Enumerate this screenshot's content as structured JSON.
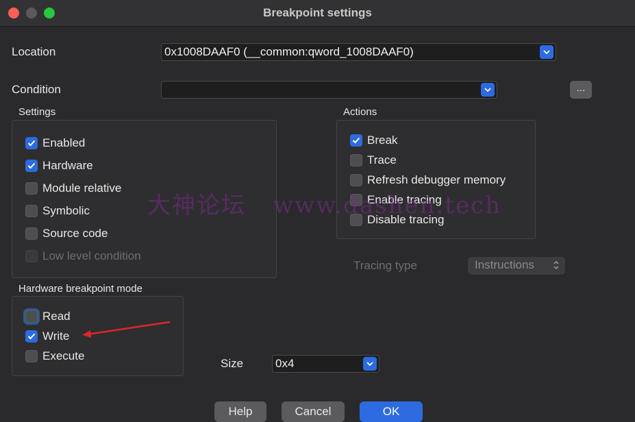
{
  "window": {
    "title": "Breakpoint settings"
  },
  "location": {
    "label": "Location",
    "value": "0x1008DAAF0 (__common:qword_1008DAAF0)"
  },
  "condition": {
    "label": "Condition",
    "value": "",
    "more_label": "..."
  },
  "settings": {
    "title": "Settings",
    "items": [
      {
        "label": "Enabled",
        "checked": true,
        "disabled": false
      },
      {
        "label": "Hardware",
        "checked": true,
        "disabled": false
      },
      {
        "label": "Module relative",
        "checked": false,
        "disabled": false
      },
      {
        "label": "Symbolic",
        "checked": false,
        "disabled": false
      },
      {
        "label": "Source code",
        "checked": false,
        "disabled": false
      },
      {
        "label": "Low level condition",
        "checked": false,
        "disabled": true
      }
    ]
  },
  "actions": {
    "title": "Actions",
    "items": [
      {
        "label": "Break",
        "checked": true
      },
      {
        "label": "Trace",
        "checked": false
      },
      {
        "label": "Refresh debugger memory",
        "checked": false
      },
      {
        "label": "Enable tracing",
        "checked": false
      },
      {
        "label": "Disable tracing",
        "checked": false
      }
    ]
  },
  "tracing": {
    "label": "Tracing type",
    "value": "Instructions"
  },
  "hw_mode": {
    "title": "Hardware breakpoint mode",
    "items": [
      {
        "label": "Read",
        "checked": false
      },
      {
        "label": "Write",
        "checked": true
      },
      {
        "label": "Execute",
        "checked": false
      }
    ]
  },
  "size": {
    "label": "Size",
    "value": "0x4"
  },
  "buttons": {
    "help": "Help",
    "cancel": "Cancel",
    "ok": "OK"
  },
  "watermark": {
    "cn": "大神论坛",
    "url": "www.dashen.tech"
  },
  "colors": {
    "accent": "#2d6be0",
    "arrow": "#e0242b"
  },
  "icons": {
    "dropdown": "chevron-down-icon",
    "checkbox": "checkmark-icon",
    "stepper": "up-down-chevron-icon"
  }
}
